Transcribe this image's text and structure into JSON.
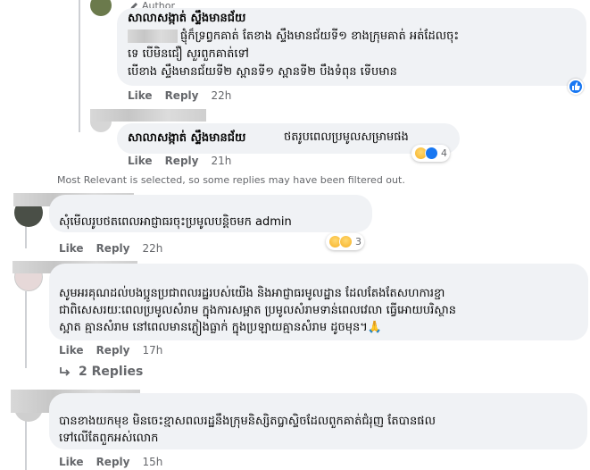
{
  "reply1": {
    "author_badge": "Author",
    "name": "សាលាសង្កាត់ ស្ទឹងមានជ័យ",
    "lines": [
      "ផ្ញុំក៏ទ្រព្វកគាត់ តែខាង ស្ទឹងមានជ័យទី១ ខាងក្រុមគាត់ អត់ដែលចុះ",
      "ទេ បើមិនជឿ សួរពួកគាត់ទៅ",
      "បើខាង ស្ទឹងមានជ័យទី២ ស្ពានទី១ ស្ពានទី២ បឹងទំពុន ទើបមាន"
    ],
    "like": "Like",
    "reply": "Reply",
    "time": "22h"
  },
  "reply2": {
    "name": "សាលាសង្កាត់ ស្ទឹងមានជ័យ",
    "text": "ថតរូបពេលប្រមូលសម្រាមផង",
    "like": "Like",
    "reply": "Reply",
    "time": "21h",
    "reaction_count": "4"
  },
  "filter_note": "Most Relevant is selected, so some replies may have been filtered out.",
  "comment1": {
    "text": "សុំមើលរូបថតពេលអាជ្ញាធរចុះប្រមូលបន្តិចមក admin",
    "like": "Like",
    "reply": "Reply",
    "time": "22h",
    "reaction_count": "3"
  },
  "comment2": {
    "lines": [
      "សូមអរគុណដល់បងប្អូនប្រជាពលរដ្ឋរបស់យើង និងអាជ្ញាធរមូលដ្ឋាន ដែលតែងតែសហការខ្ជា",
      "ជាពិសេសរយៈពេលប្រមូលសំរាម ក្នុងការសម្អាត ប្រមូលសំរាមទាន់ពេលវេលា ធ្វើអោយបរិស្ថាន",
      "ស្អាត គ្មានសំរាម នៅពេលមានភ្លៀងធ្លាក់ ក្នុងប្រឡាយគ្មានសំរាម ដូចមុន។🙏"
    ],
    "like": "Like",
    "reply": "Reply",
    "time": "17h",
    "replies_label": "2 Replies"
  },
  "comment3": {
    "lines": [
      "បានខាងយកមុខ មិនចេះខ្មាសពលរដ្ឋនឹងក្រុមនិស្សិតប្លាស្ទិចដែលពួកគាត់ជំរុញ តែបានផល",
      "ទៅលើតែពួកអស់លោក"
    ],
    "like": "Like",
    "reply": "Reply",
    "time": "15h"
  },
  "colors": {
    "bubble": "#f0f2f5",
    "meta": "#65676b",
    "like_blue": "#1877f2"
  }
}
